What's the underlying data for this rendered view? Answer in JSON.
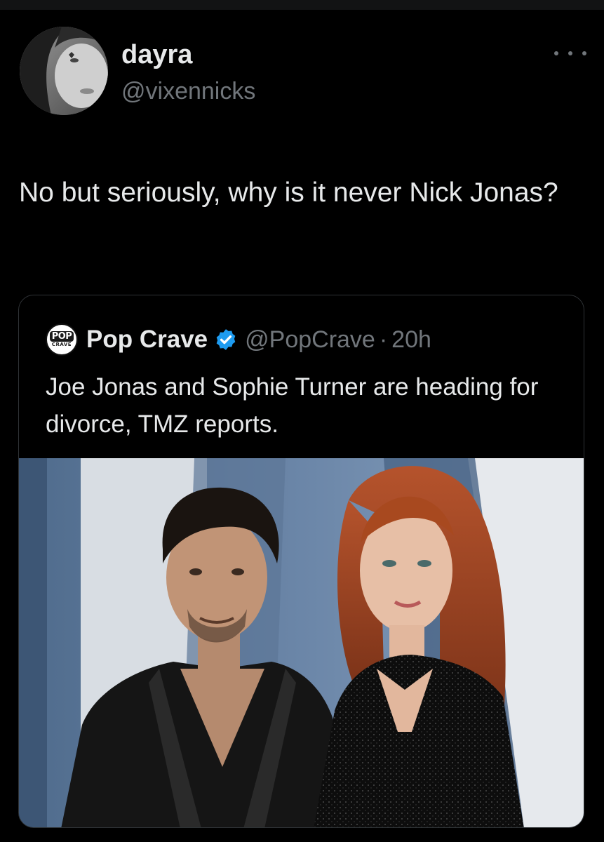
{
  "tweet": {
    "author": {
      "display_name": "dayra",
      "handle": "@vixennicks",
      "avatar_icon": "profile-photo"
    },
    "more_icon": "ellipsis-icon",
    "text": "No but seriously, why is it never Nick Jonas?"
  },
  "quote": {
    "author": {
      "display_name": "Pop Crave",
      "handle": "@PopCrave",
      "verified": true,
      "avatar_text_top": "POP",
      "avatar_text_bottom": "CRAVE"
    },
    "separator": "·",
    "time": "20h",
    "text": "Joe Jonas and Sophie Turner are heading for divorce, TMZ reports.",
    "image_icon": "photo-of-couple"
  },
  "colors": {
    "background": "#000000",
    "primary_text": "#e7e9ea",
    "secondary_text": "#71767b",
    "border": "#2f3336",
    "verified_blue": "#1d9bf0"
  }
}
